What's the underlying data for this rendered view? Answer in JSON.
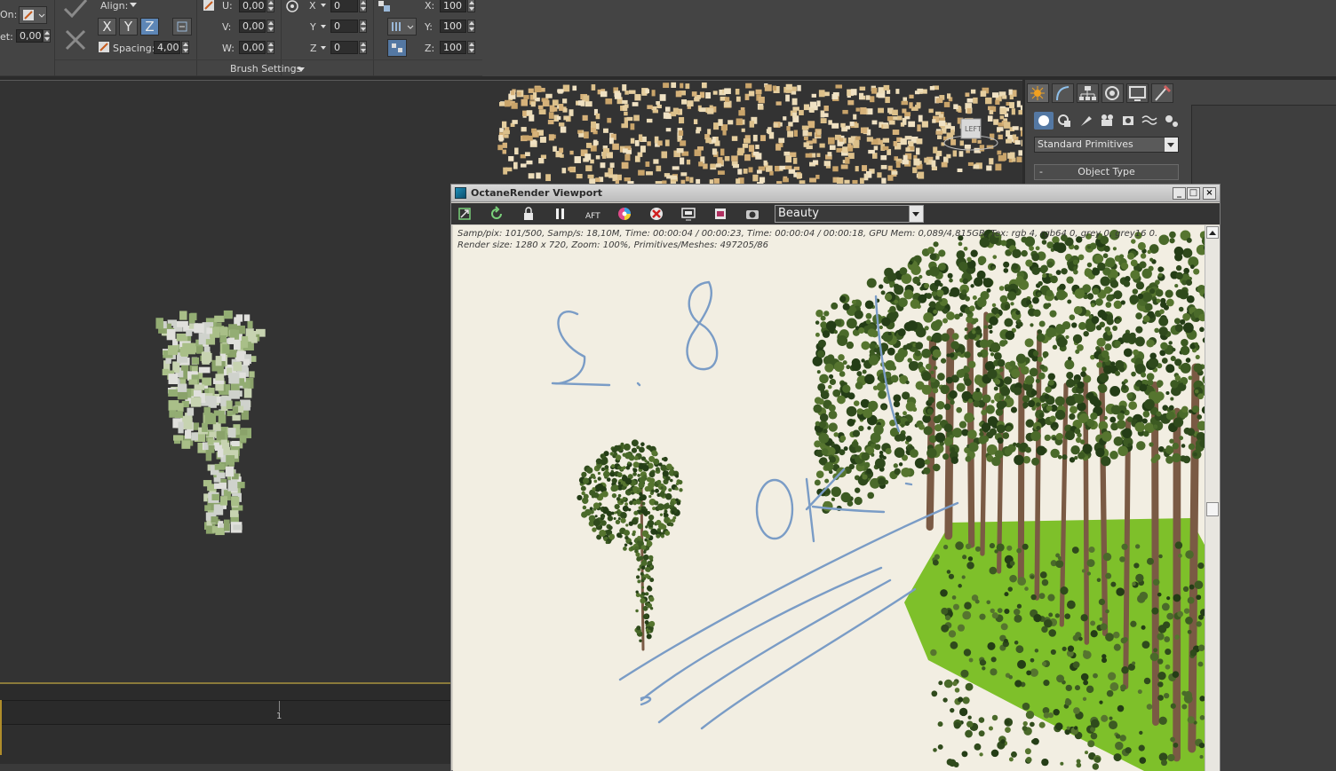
{
  "ribbon": {
    "on_label": "On:",
    "offset_label": "et:",
    "offset_value": "0,00",
    "align_label": "Align:",
    "x_button": "X",
    "y_button": "Y",
    "z_button": "Z",
    "spacing_label": "Spacing:",
    "spacing_value": "4,00",
    "u_label": "U:",
    "u_value": "0,00",
    "v_label": "V:",
    "v_value": "0,00",
    "w_label": "W:",
    "w_value": "0,00",
    "rot_x_label": "X",
    "rot_x_value": "0",
    "rot_y_label": "Y",
    "rot_y_value": "0",
    "rot_z_label": "Z",
    "rot_z_value": "0",
    "scale_x_label": "X:",
    "scale_x_value": "100",
    "scale_y_label": "Y:",
    "scale_y_value": "100",
    "scale_z_label": "Z:",
    "scale_z_value": "100",
    "brush_settings": "Brush Settings"
  },
  "viewcube": {
    "label": "LEFT"
  },
  "timeline": {
    "frame_tick": "1"
  },
  "command_panel": {
    "tabs": [
      "create-tab",
      "modify-tab",
      "hierarchy-tab",
      "motion-tab",
      "display-tab",
      "utilities-tab"
    ],
    "category": "Standard Primitives",
    "rollout_toggle": "-",
    "rollout": "Object Type"
  },
  "octane": {
    "title": "OctaneRender Viewport",
    "minimize": "_",
    "maximize": "□",
    "close": "×",
    "pass": "Beauty",
    "stats_line1": "Samp/pix: 101/500,   Samp/s: 18,10M,   Time: 00:00:04 / 00:00:23,   Time: 00:00:04 / 00:00:18,   GPU Mem: 0,089/4,815GB,   Tex: rgb 4, rgb64 0, grey 0, grey16 0.",
    "stats_line2": "Render size: 1280 x 720,   Zoom: 100%,   Primitives/Meshes: 497205/86",
    "toolbar_icons": [
      "send-scene-icon",
      "restart-icon",
      "lock-icon",
      "pause-icon",
      "aft-icon",
      "color-wheel-icon",
      "clear-icon",
      "region-icon",
      "film-icon",
      "camera-icon"
    ]
  },
  "annotations": {
    "number": "2.8",
    "ok": "OK"
  },
  "colors": {
    "ui_dark": "#444444",
    "viewport": "#333333",
    "render_bg": "#f2eee2",
    "accent_blue": "#5d86b6",
    "grass": "#7ec02a",
    "ink": "#7a9cc6"
  }
}
